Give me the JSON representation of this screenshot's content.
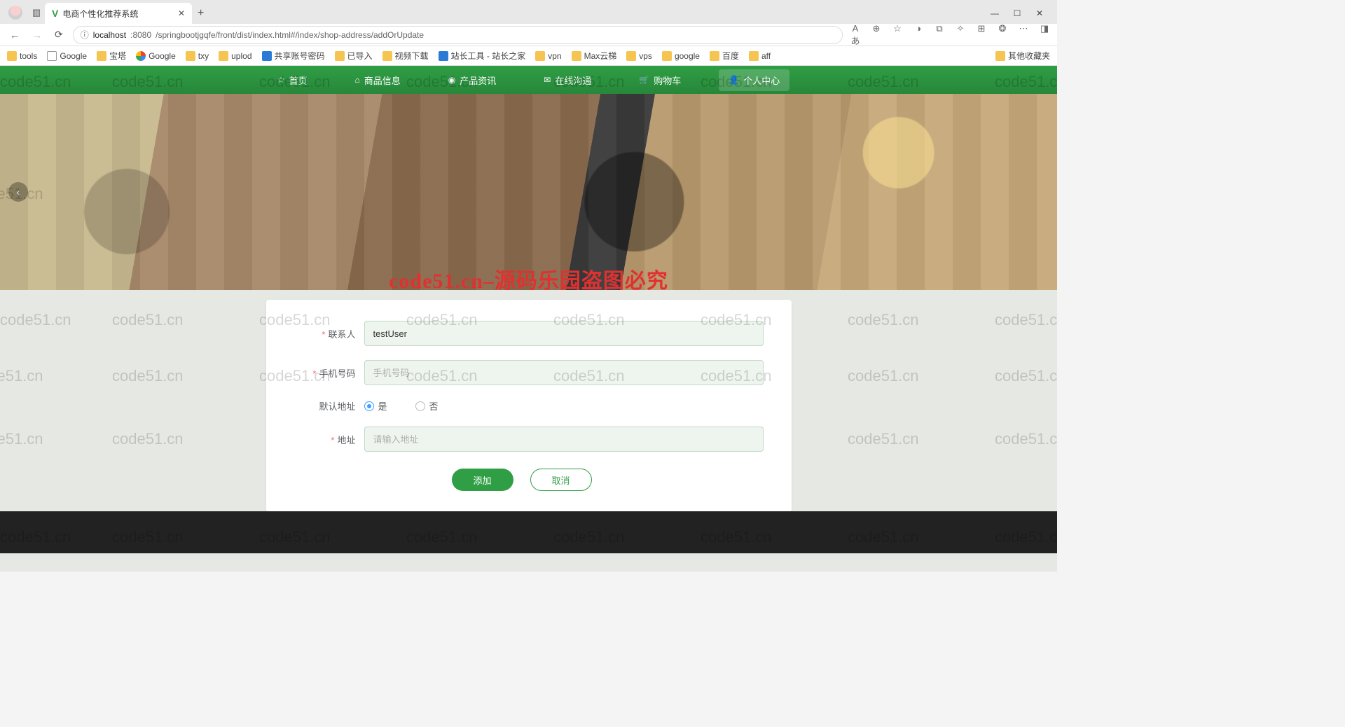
{
  "browser": {
    "tab_title": "电商个性化推荐系统",
    "url_host": "localhost",
    "url_port": ":8080",
    "url_path": "/springbootjgqfe/front/dist/index.html#/index/shop-address/addOrUpdate",
    "other_bookmarks": "其他收藏夹"
  },
  "bookmarks": [
    {
      "label": "tools",
      "kind": "folder"
    },
    {
      "label": "Google",
      "kind": "page"
    },
    {
      "label": "宝塔",
      "kind": "folder"
    },
    {
      "label": "Google",
      "kind": "google"
    },
    {
      "label": "txy",
      "kind": "folder"
    },
    {
      "label": "uplod",
      "kind": "folder"
    },
    {
      "label": "共享账号密码",
      "kind": "blue"
    },
    {
      "label": "已导入",
      "kind": "folder"
    },
    {
      "label": "视频下载",
      "kind": "folder"
    },
    {
      "label": "站长工具 - 站长之家",
      "kind": "blue"
    },
    {
      "label": "vpn",
      "kind": "folder"
    },
    {
      "label": "Max云梯",
      "kind": "folder"
    },
    {
      "label": "vps",
      "kind": "folder"
    },
    {
      "label": "google",
      "kind": "folder"
    },
    {
      "label": "百度",
      "kind": "folder"
    },
    {
      "label": "aff",
      "kind": "folder"
    }
  ],
  "nav": {
    "home": "首页",
    "goods": "商品信息",
    "news": "产品资讯",
    "chat": "在线沟通",
    "cart": "购物车",
    "user": "个人中心"
  },
  "watermark_red": "code51.cn–源码乐园盗图必究",
  "watermark_grey": "code51.cn",
  "form": {
    "contact_label": "联系人",
    "contact_value": "testUser",
    "phone_label": "手机号码",
    "phone_placeholder": "手机号码",
    "default_label": "默认地址",
    "radio_yes": "是",
    "radio_no": "否",
    "addr_label": "地址",
    "addr_placeholder": "请输入地址",
    "submit": "添加",
    "cancel": "取消"
  }
}
